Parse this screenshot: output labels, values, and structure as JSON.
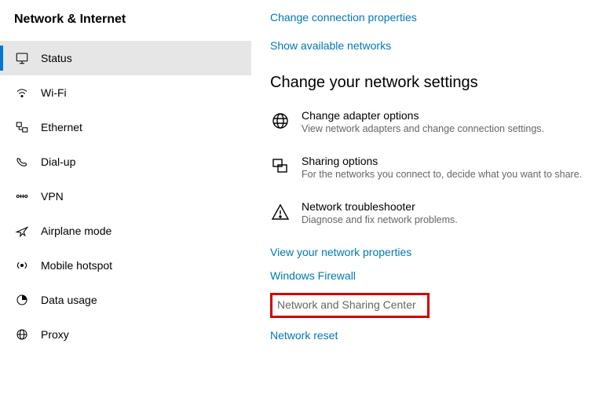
{
  "sidebar": {
    "title": "Network & Internet",
    "items": [
      {
        "label": "Status",
        "icon": "status-icon",
        "selected": true
      },
      {
        "label": "Wi-Fi",
        "icon": "wifi-icon"
      },
      {
        "label": "Ethernet",
        "icon": "ethernet-icon"
      },
      {
        "label": "Dial-up",
        "icon": "dialup-icon"
      },
      {
        "label": "VPN",
        "icon": "vpn-icon"
      },
      {
        "label": "Airplane mode",
        "icon": "airplane-icon"
      },
      {
        "label": "Mobile hotspot",
        "icon": "hotspot-icon"
      },
      {
        "label": "Data usage",
        "icon": "datausage-icon"
      },
      {
        "label": "Proxy",
        "icon": "proxy-icon"
      }
    ]
  },
  "topLinks": {
    "changeConnection": "Change connection properties",
    "showNetworks": "Show available networks"
  },
  "sectionHeading": "Change your network settings",
  "settings": [
    {
      "title": "Change adapter options",
      "desc": "View network adapters and change connection settings."
    },
    {
      "title": "Sharing options",
      "desc": "For the networks you connect to, decide what you want to share."
    },
    {
      "title": "Network troubleshooter",
      "desc": "Diagnose and fix network problems."
    }
  ],
  "bottomLinks": {
    "viewProps": "View your network properties",
    "firewall": "Windows Firewall",
    "sharingCenter": "Network and Sharing Center",
    "reset": "Network reset"
  }
}
